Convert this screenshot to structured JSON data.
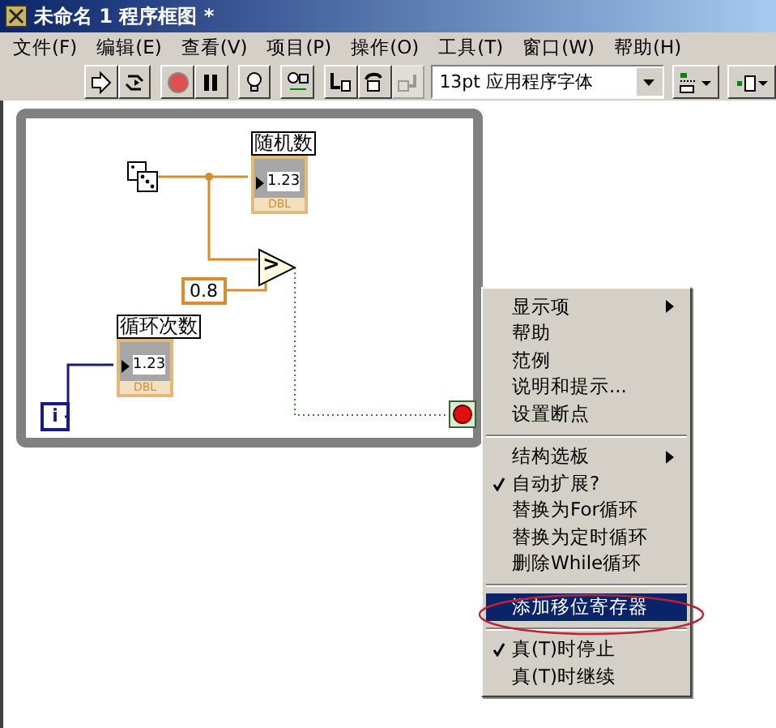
{
  "window": {
    "title": "未命名 1 程序框图 *"
  },
  "menu_bar": [
    {
      "label": "文件(F)"
    },
    {
      "label": "编辑(E)"
    },
    {
      "label": "查看(V)"
    },
    {
      "label": "项目(P)"
    },
    {
      "label": "操作(O)"
    },
    {
      "label": "工具(T)"
    },
    {
      "label": "窗口(W)"
    },
    {
      "label": "帮助(H)"
    }
  ],
  "toolbar": {
    "buttons": [
      {
        "kind": "run",
        "disabled": false
      },
      {
        "kind": "run-continuously",
        "disabled": false
      },
      {
        "kind": "abort",
        "disabled": false
      },
      {
        "kind": "pause",
        "disabled": false
      },
      {
        "kind": "highlight",
        "disabled": false
      },
      {
        "kind": "retain",
        "disabled": false
      },
      {
        "kind": "step-into",
        "disabled": false
      },
      {
        "kind": "step-over",
        "disabled": false
      },
      {
        "kind": "step-out",
        "disabled": true
      }
    ],
    "font_dropdown": {
      "value": "13pt 应用程序字体"
    }
  },
  "diagram": {
    "random_indicator": {
      "label": "随机数",
      "value": "1.23",
      "type": "DBL"
    },
    "compare": {
      "symbol": ">"
    },
    "constant": {
      "value": "0.8"
    },
    "count_indicator": {
      "label": "循环次数",
      "value": "1.23",
      "type": "DBL"
    },
    "iteration_terminal": {
      "label": "i"
    }
  },
  "context_menu": [
    {
      "kind": "item",
      "label": "显示项",
      "submenu": true,
      "checked": false,
      "selected": false
    },
    {
      "kind": "item",
      "label": "帮助",
      "submenu": false,
      "checked": false,
      "selected": false
    },
    {
      "kind": "item",
      "label": "范例",
      "submenu": false,
      "checked": false,
      "selected": false
    },
    {
      "kind": "item",
      "label": "说明和提示...",
      "submenu": false,
      "checked": false,
      "selected": false
    },
    {
      "kind": "item",
      "label": "设置断点",
      "submenu": false,
      "checked": false,
      "selected": false
    },
    {
      "kind": "separator"
    },
    {
      "kind": "item",
      "label": "结构选板",
      "submenu": true,
      "checked": false,
      "selected": false
    },
    {
      "kind": "item",
      "label": "自动扩展?",
      "submenu": false,
      "checked": true,
      "selected": false
    },
    {
      "kind": "item",
      "label": "替换为For循环",
      "submenu": false,
      "checked": false,
      "selected": false
    },
    {
      "kind": "item",
      "label": "替换为定时循环",
      "submenu": false,
      "checked": false,
      "selected": false
    },
    {
      "kind": "item",
      "label": "删除While循环",
      "submenu": false,
      "checked": false,
      "selected": false
    },
    {
      "kind": "separator"
    },
    {
      "kind": "item",
      "label": "添加移位寄存器",
      "submenu": false,
      "checked": false,
      "selected": true
    },
    {
      "kind": "separator"
    },
    {
      "kind": "item",
      "label": "真(T)时停止",
      "submenu": false,
      "checked": true,
      "selected": false
    },
    {
      "kind": "item",
      "label": "真(T)时继续",
      "submenu": false,
      "checked": false,
      "selected": false
    }
  ]
}
